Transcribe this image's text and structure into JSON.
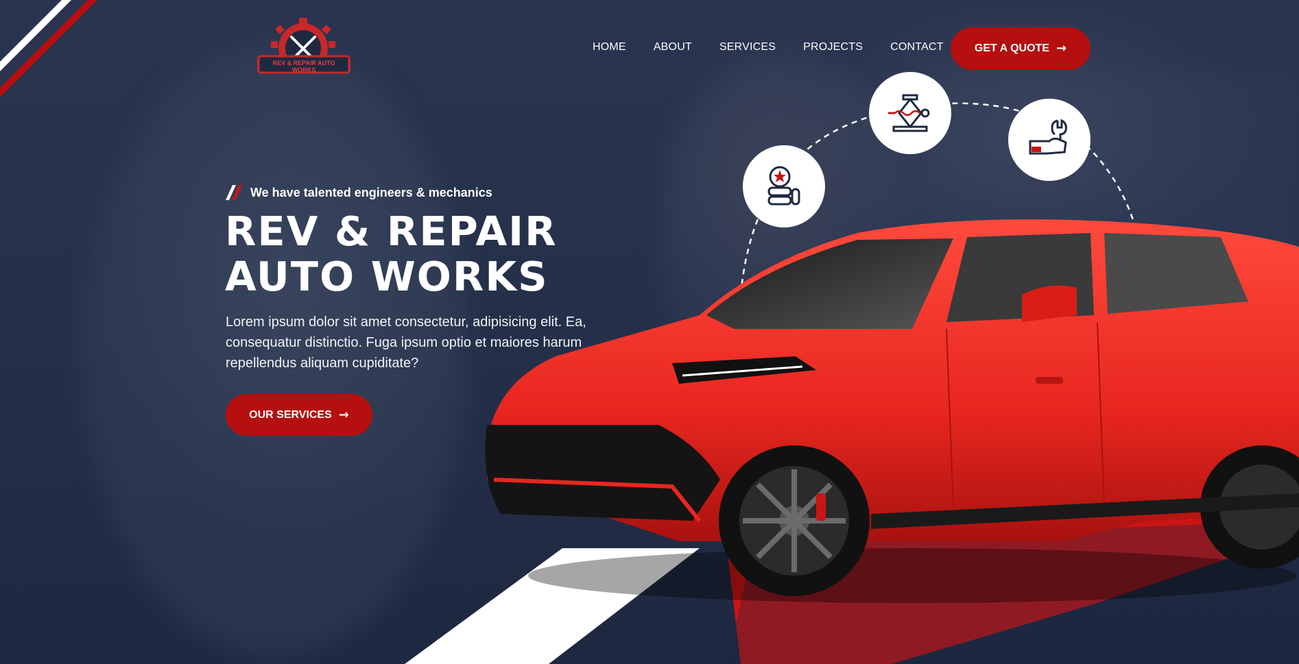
{
  "brand": {
    "logo_text": "REV & REPAIR AUTO WORKS"
  },
  "nav": {
    "items": [
      "HOME",
      "ABOUT",
      "SERVICES",
      "PROJECTS",
      "CONTACT"
    ],
    "cta_label": "GET A QUOTE"
  },
  "hero": {
    "tagline": "We have talented engineers & mechanics",
    "title": "REV & REPAIR AUTO WORKS",
    "description": "Lorem ipsum dolor sit amet consectetur, adipisicing elit. Ea, consequatur distinctio. Fuga ipsum optio et maiores harum repellendus aliquam cupiditate?",
    "button_label": "OUR SERVICES"
  },
  "service_icons": [
    "tires-icon",
    "car-jack-icon",
    "wrench-hand-icon"
  ],
  "colors": {
    "accent": "#b50f0f",
    "background": "#1f2940",
    "car": "#e8261f"
  }
}
